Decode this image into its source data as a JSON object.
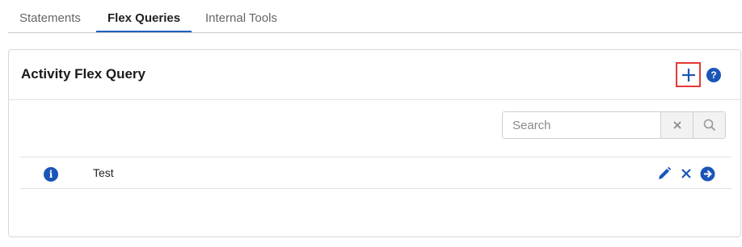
{
  "tabs": [
    {
      "label": "Statements",
      "active": false
    },
    {
      "label": "Flex Queries",
      "active": true
    },
    {
      "label": "Internal Tools",
      "active": false
    }
  ],
  "panel": {
    "title": "Activity Flex Query",
    "add_icon": "plus-icon",
    "help_icon": "question-circle-icon",
    "help_glyph": "?"
  },
  "search": {
    "placeholder": "Search",
    "value": "",
    "clear_icon": "close-icon",
    "submit_icon": "search-icon"
  },
  "queries": [
    {
      "label": "Test",
      "info_icon": "info-icon",
      "info_glyph": "i",
      "actions": [
        "edit-pencil-icon",
        "delete-x-icon",
        "run-arrow-icon"
      ]
    }
  ],
  "colors": {
    "accent": "#1a56b8",
    "active_tab_underline": "#1f5fbf",
    "highlight_border": "#e53935"
  }
}
